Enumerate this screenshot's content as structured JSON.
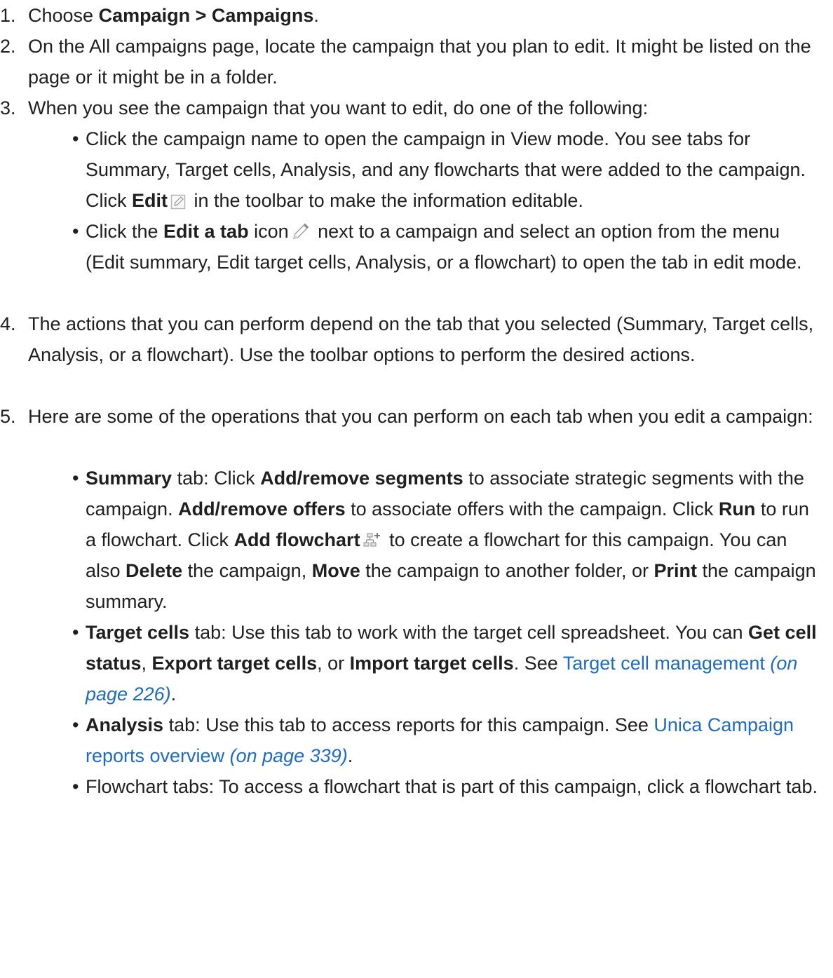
{
  "steps": {
    "s1": {
      "num": "1.",
      "pre": "Choose ",
      "bold": "Campaign >  Campaigns",
      "post": "."
    },
    "s2": {
      "num": "2.",
      "text": "On the All campaigns page, locate the campaign that you plan to edit. It might be listed on the page or it might be in a folder."
    },
    "s3": {
      "num": "3.",
      "text": "When you see the campaign that you want to edit, do one of the following:",
      "b1": {
        "pre": "Click the campaign name to open the campaign in View mode. You see tabs for Summary, Target cells, Analysis, and any flowcharts that were added to the campaign. Click ",
        "bold": "Edit",
        "post": " in the toolbar to make the information editable."
      },
      "b2": {
        "pre": "Click the ",
        "bold": "Edit a tab",
        "mid": " icon",
        "post": " next to a campaign and select an option from the menu (Edit summary, Edit target cells, Analysis, or a flowchart) to open the tab in edit mode."
      }
    },
    "s4": {
      "num": "4.",
      "text": "The actions that you can perform depend on the tab that you selected (Summary, Target cells, Analysis, or a flowchart). Use the toolbar options to perform the desired actions."
    },
    "s5": {
      "num": "5.",
      "text": "Here are some of the operations that you can perform on each tab when you edit a campaign:",
      "summary": {
        "b1": "Summary",
        "t1": " tab: Click ",
        "b2": "Add/remove segments",
        "t2": " to associate strategic segments with the campaign. ",
        "b3": "Add/remove offers",
        "t3": " to associate offers with the campaign. Click ",
        "b4": "Run",
        "t4": " to run a flowchart. Click ",
        "b5": "Add flowchart",
        "t5": " to create a flowchart for this campaign. You can also ",
        "b6": "Delete",
        "t6": " the campaign, ",
        "b7": "Move",
        "t7": " the campaign to another folder, or ",
        "b8": "Print",
        "t8": " the campaign summary."
      },
      "target": {
        "b1": "Target cells",
        "t1": " tab: Use this tab to work with the target cell spreadsheet. You can ",
        "b2": "Get cell status",
        "t2": ", ",
        "b3": "Export target cells",
        "t3": ", or ",
        "b4": "Import target cells",
        "t4": ". See ",
        "link": "Target cell management",
        "page": " (on page 226)",
        "end": "."
      },
      "analysis": {
        "b1": "Analysis",
        "t1": " tab: Use this tab to access reports for this campaign. See ",
        "link": "Unica Campaign reports overview",
        "page": " (on page 339)",
        "end": "."
      },
      "flowchart": {
        "text": "Flowchart tabs: To access a flowchart that is part of this campaign, click a flowchart tab."
      }
    }
  },
  "bullet_char": "•",
  "icons": {
    "edit": "edit-pencil-box-icon",
    "edit_tab": "pencil-icon",
    "add_flowchart": "add-flowchart-icon"
  },
  "colors": {
    "link": "#1f6bbf",
    "text": "#1f1f1f"
  }
}
